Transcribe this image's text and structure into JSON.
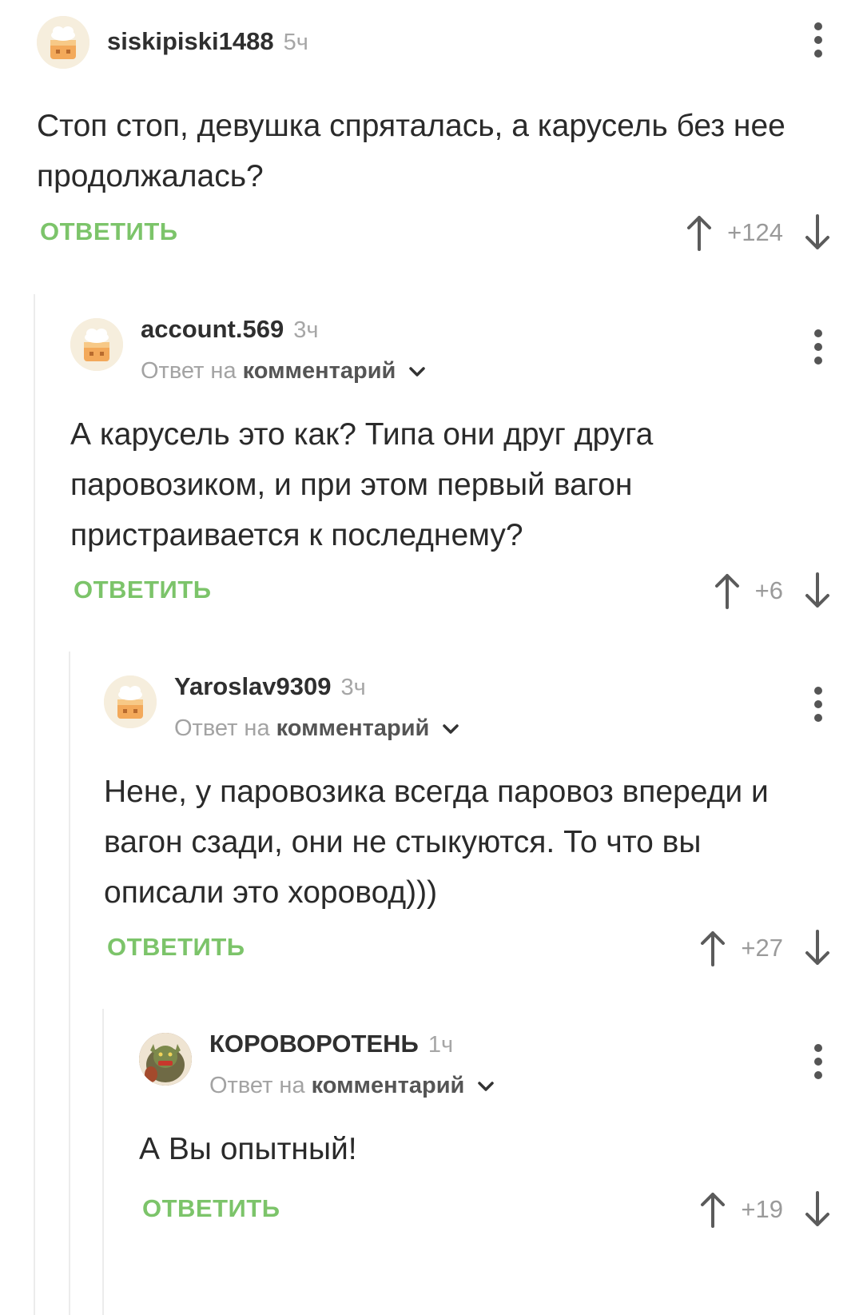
{
  "comments": [
    {
      "username": "siskipiski1488",
      "time": "5ч",
      "reply_prefix": "",
      "reply_link": "",
      "text": "Стоп стоп, девушка спряталась, а карусель без нее продолжалась?",
      "reply_label": "ОТВЕТИТЬ",
      "score": "+124",
      "avatar": "default-cake-avatar"
    },
    {
      "username": "account.569",
      "time": "3ч",
      "reply_prefix": "Ответ на",
      "reply_link": "комментарий",
      "text": "А карусель это как? Типа они друг друга паровозиком, и при этом первый вагон пристраивается к последнему?",
      "reply_label": "ОТВЕТИТЬ",
      "score": "+6",
      "avatar": "default-cake-avatar"
    },
    {
      "username": "Yaroslav9309",
      "time": "3ч",
      "reply_prefix": "Ответ на",
      "reply_link": "комментарий",
      "text": "Нене, у паровозика всегда паровоз впереди и вагон сзади, они не стыкуются. То что вы описали это хоровод)))",
      "reply_label": "ОТВЕТИТЬ",
      "score": "+27",
      "avatar": "default-cake-avatar"
    },
    {
      "username": "КОРОВОРОТЕНЬ",
      "time": "1ч",
      "reply_prefix": "Ответ на",
      "reply_link": "комментарий",
      "text": "А Вы опытный!",
      "reply_label": "ОТВЕТИТЬ",
      "score": "+19",
      "avatar": "goblin-photo-avatar"
    }
  ],
  "colors": {
    "accent_green": "#7cc46a",
    "muted_text": "#a3a3a3",
    "thread_line": "#ececec"
  }
}
